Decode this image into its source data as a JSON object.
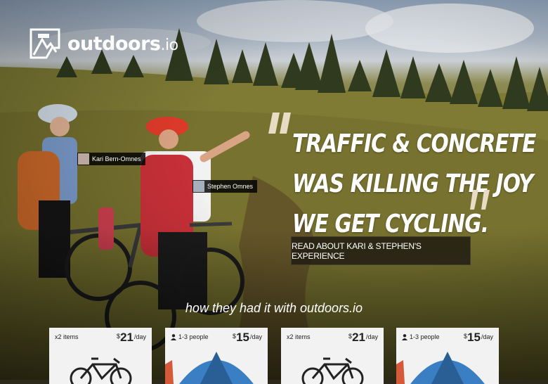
{
  "brand": {
    "name": "outdoors",
    "tld": ".io"
  },
  "tags": {
    "kari": "Kari Bern-Omnes",
    "stephen": "Stephen Omnes"
  },
  "quote": {
    "lines": [
      "TRAFFIC & CONCRETE",
      "WAS KILLING THE JOY",
      "WE GET CYCLING."
    ]
  },
  "cta": {
    "label": "READ ABOUT KARI & STEPHEN'S EXPERIENCE"
  },
  "subtitle": "how they had it with outdoors.io",
  "cards": [
    {
      "label": "x2 items",
      "icon": "bike",
      "currency": "$",
      "amount": "21",
      "period": "/day"
    },
    {
      "label": "1-3 people",
      "icon": "tent",
      "currency": "$",
      "amount": "15",
      "period": "/day"
    },
    {
      "label": "x2 items",
      "icon": "bike",
      "currency": "$",
      "amount": "21",
      "period": "/day"
    },
    {
      "label": "1-3 people",
      "icon": "tent",
      "currency": "$",
      "amount": "15",
      "period": "/day"
    }
  ],
  "colors": {
    "accent": "#e8dcc4",
    "cta_bg": "#221e12",
    "card_bg": "#f2f2f2"
  }
}
